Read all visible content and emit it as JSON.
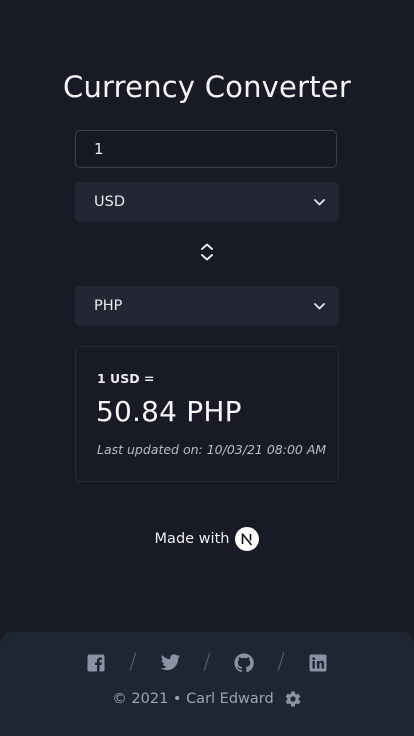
{
  "header": {
    "title": "Currency Converter"
  },
  "converter": {
    "amount_value": "1",
    "from_currency": "USD",
    "to_currency": "PHP"
  },
  "result": {
    "rate_label": "1 USD =",
    "rate_value": "50.84 PHP",
    "updated_text": "Last updated on: 10/03/21 08:00 AM"
  },
  "made_with": {
    "label": "Made with",
    "logo_icon": "nextjs-logo-icon"
  },
  "footer": {
    "socials": [
      "facebook-icon",
      "twitter-icon",
      "github-icon",
      "linkedin-icon"
    ],
    "separator": "/",
    "copyright": "© 2021 • Carl Edward",
    "settings_icon": "gear-icon"
  },
  "colors": {
    "background": "#181b25",
    "surface": "#232633",
    "footer": "#202533",
    "text": "#f1f2f5",
    "muted": "#9fa4b2"
  }
}
